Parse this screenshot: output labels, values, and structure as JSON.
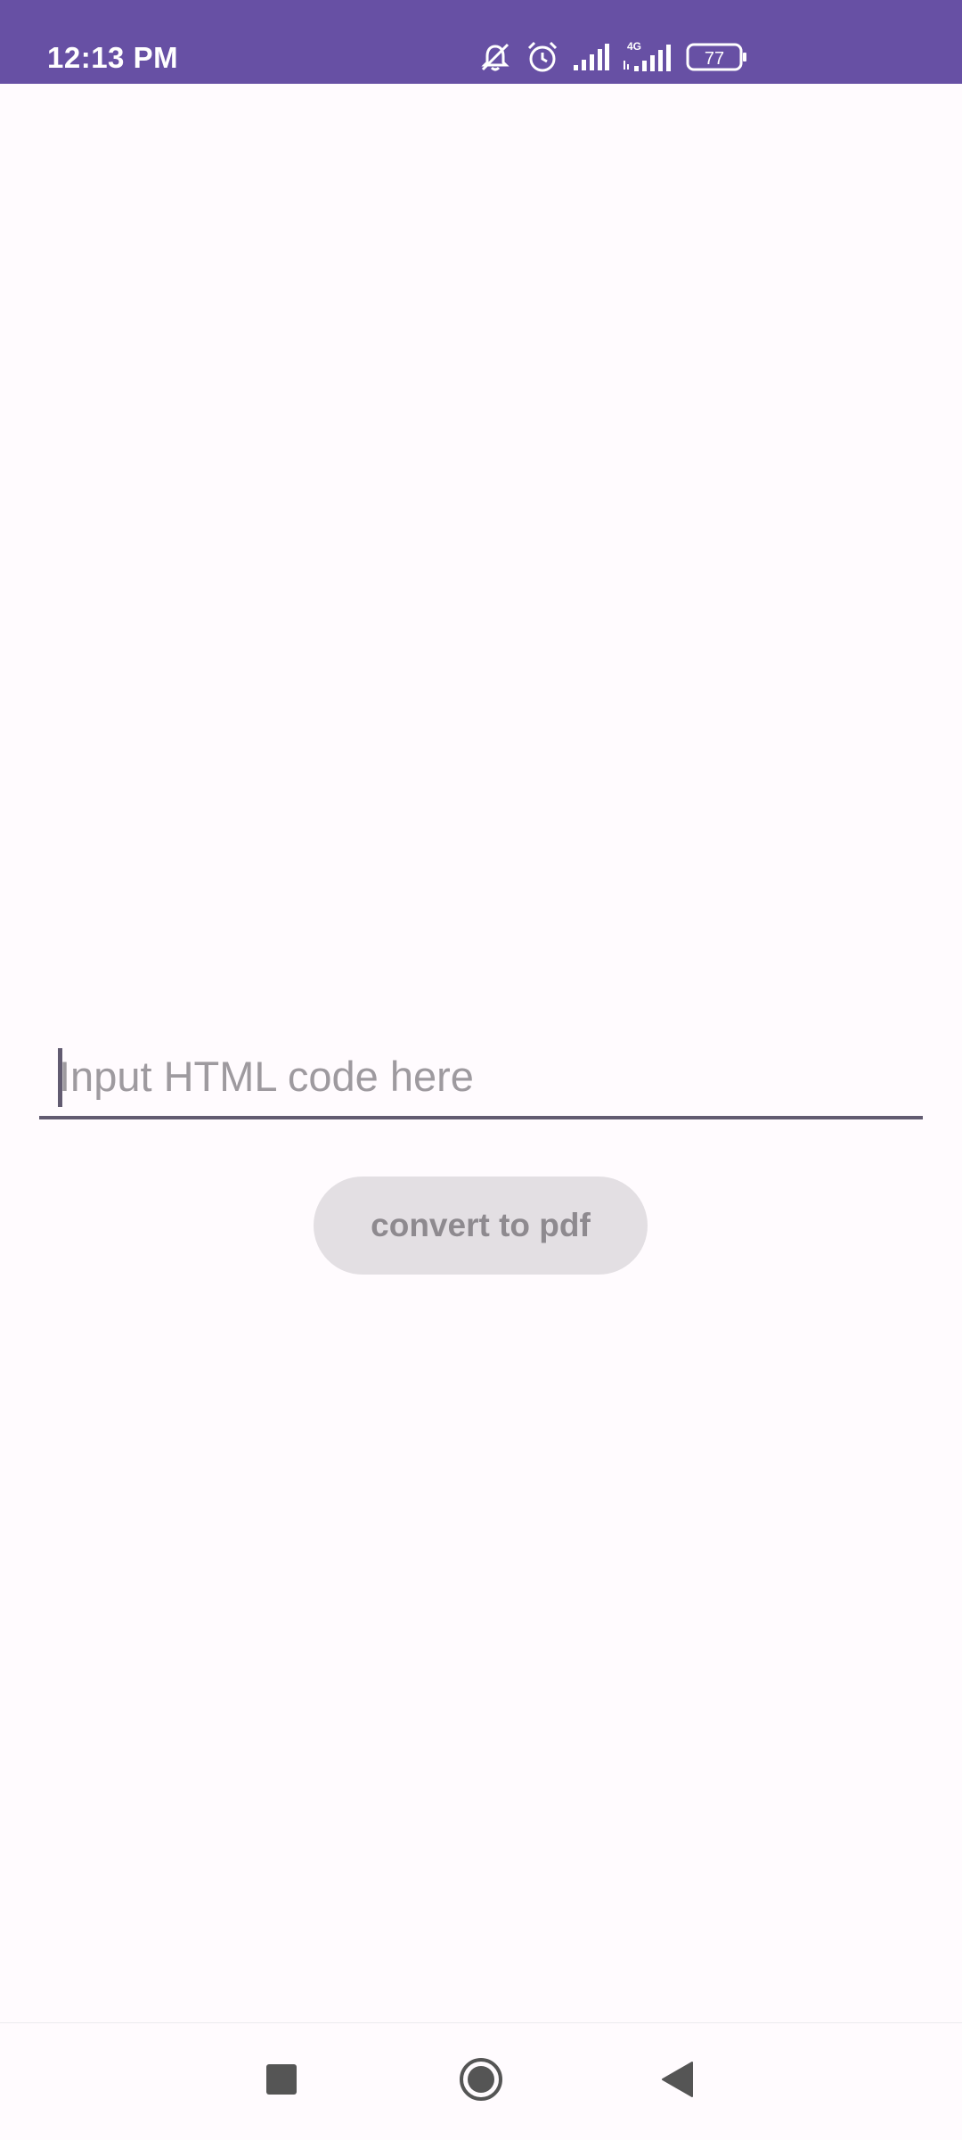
{
  "status_bar": {
    "time": "12:13 PM",
    "battery_level": "77",
    "network_type": "4G",
    "icons": [
      "vibrate-off-icon",
      "alarm-icon",
      "signal-icon",
      "signal-4g-icon",
      "battery-icon"
    ],
    "background_color": "#6750a4"
  },
  "main": {
    "input_placeholder": "Input HTML code here",
    "input_value": "",
    "convert_button_label": "convert to pdf"
  },
  "nav_bar": {
    "icons": [
      "recents-square-icon",
      "home-circle-icon",
      "back-triangle-icon"
    ]
  },
  "colors": {
    "background": "#fffbfe",
    "accent": "#6750a4",
    "underline": "#625b71",
    "button_disabled_bg": "#e3dfe3",
    "button_disabled_text": "#8e8a8f"
  }
}
